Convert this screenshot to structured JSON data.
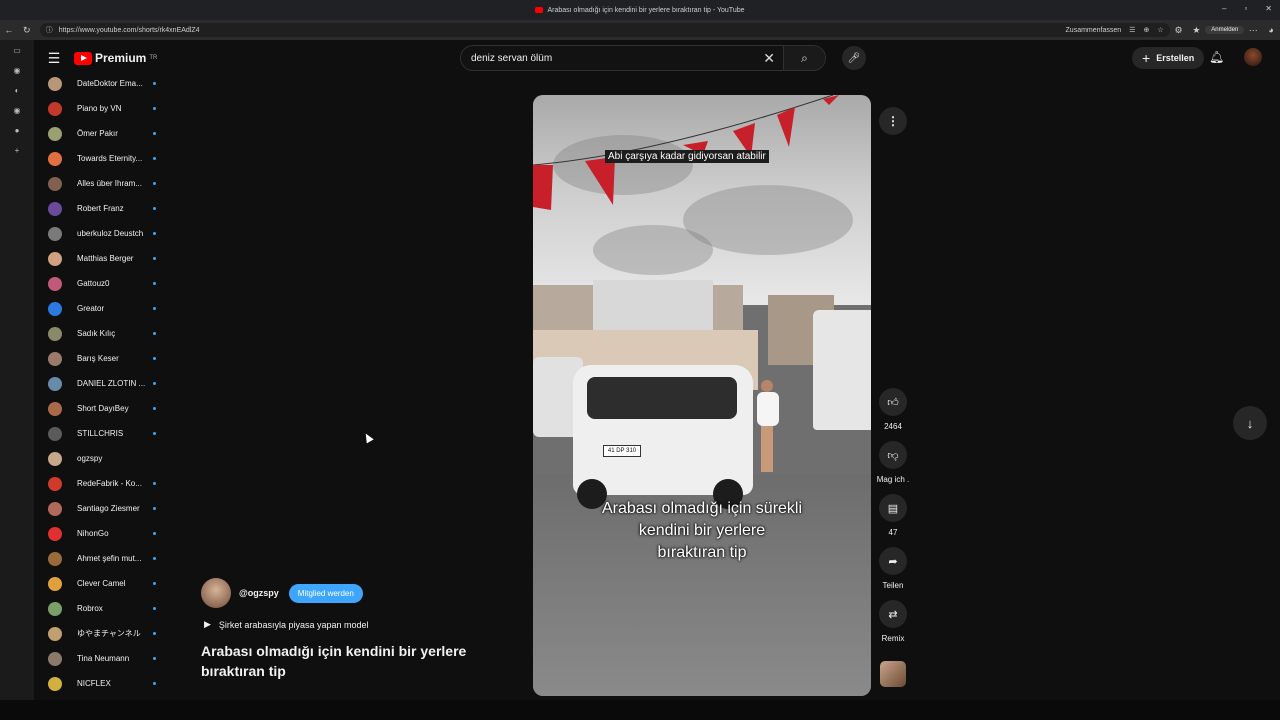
{
  "browser": {
    "tab_title": "Arabası olmadığı için kendini bir yerlere bıraktıran tip - YouTube",
    "url": "https://www.youtube.com/shorts/rk4xnEAdlZ4",
    "summarize_label": "Zusammenfassen",
    "signin_label": "Anmelden"
  },
  "masthead": {
    "logo_text": "Premium",
    "logo_sup": "TR",
    "search_value": "deniz servan ölüm",
    "create_label": "Erstellen"
  },
  "sidebar": {
    "items": [
      {
        "name": "DateDoktor Ema...",
        "color": "#b8967a",
        "new": true
      },
      {
        "name": "Piano by VN",
        "color": "#c0392b",
        "new": true
      },
      {
        "name": "Ömer Pakır",
        "color": "#9aa070",
        "new": true
      },
      {
        "name": "Towards Eternity...",
        "color": "#e07040",
        "new": true
      },
      {
        "name": "Alles über Ihram...",
        "color": "#806050",
        "new": true
      },
      {
        "name": "Robert Franz",
        "color": "#6a4a9a",
        "new": true
      },
      {
        "name": "uberkuloz Deustch",
        "color": "#7a7a7a",
        "new": true
      },
      {
        "name": "Matthias Berger",
        "color": "#d0a080",
        "new": true
      },
      {
        "name": "Gattouz0",
        "color": "#c05a7a",
        "new": true
      },
      {
        "name": "Greator",
        "color": "#2a7ae0",
        "new": true
      },
      {
        "name": "Sadık Kılıç",
        "color": "#8a8a6a",
        "new": true
      },
      {
        "name": "Barış Keser",
        "color": "#9a7a6a",
        "new": true
      },
      {
        "name": "DANIEL ZLOTIN ...",
        "color": "#6a8aaa",
        "new": true
      },
      {
        "name": "Short DayıBey",
        "color": "#aa6a4a",
        "new": true
      },
      {
        "name": "STILLCHRIS",
        "color": "#5a5a5a",
        "new": true
      },
      {
        "name": "ogzspy",
        "color": "#c8a88a",
        "new": false
      },
      {
        "name": "RedeFabrik - Ko...",
        "color": "#d03a2a",
        "new": true
      },
      {
        "name": "Santiago Ziesmer",
        "color": "#b06a5a",
        "new": true
      },
      {
        "name": "NihonGo",
        "color": "#e03030",
        "new": true
      },
      {
        "name": "Ahmet şefin mut...",
        "color": "#9a6a3a",
        "new": true
      },
      {
        "name": "Clever Camel",
        "color": "#e0a040",
        "new": true
      },
      {
        "name": "Robrox",
        "color": "#7aa06a",
        "new": true
      },
      {
        "name": "ゆやまチャンネル",
        "color": "#c0a070",
        "new": true
      },
      {
        "name": "Tina Neumann",
        "color": "#8a7a6a",
        "new": true
      },
      {
        "name": "NICFLEX",
        "color": "#d0b040",
        "new": true
      }
    ]
  },
  "video": {
    "caption_top": "Abi çarşıya kadar gidiyorsan atabilir",
    "caption_main": "Arabası olmadığı için sürekli\nkendini bir yerlere\nbıraktıran tip",
    "plate": "41 DP 310"
  },
  "actions": {
    "likes": "2464",
    "dislike_label": "Mag ich .",
    "comments": "47",
    "share_label": "Teilen",
    "remix_label": "Remix"
  },
  "meta": {
    "channel_handle": "@ogzspy",
    "join_label": "Mitglied werden",
    "sound_text": "Şirket arabasıyla piyasa yapan model",
    "title": "Arabası olmadığı için kendini bir yerlere bıraktıran tip"
  }
}
